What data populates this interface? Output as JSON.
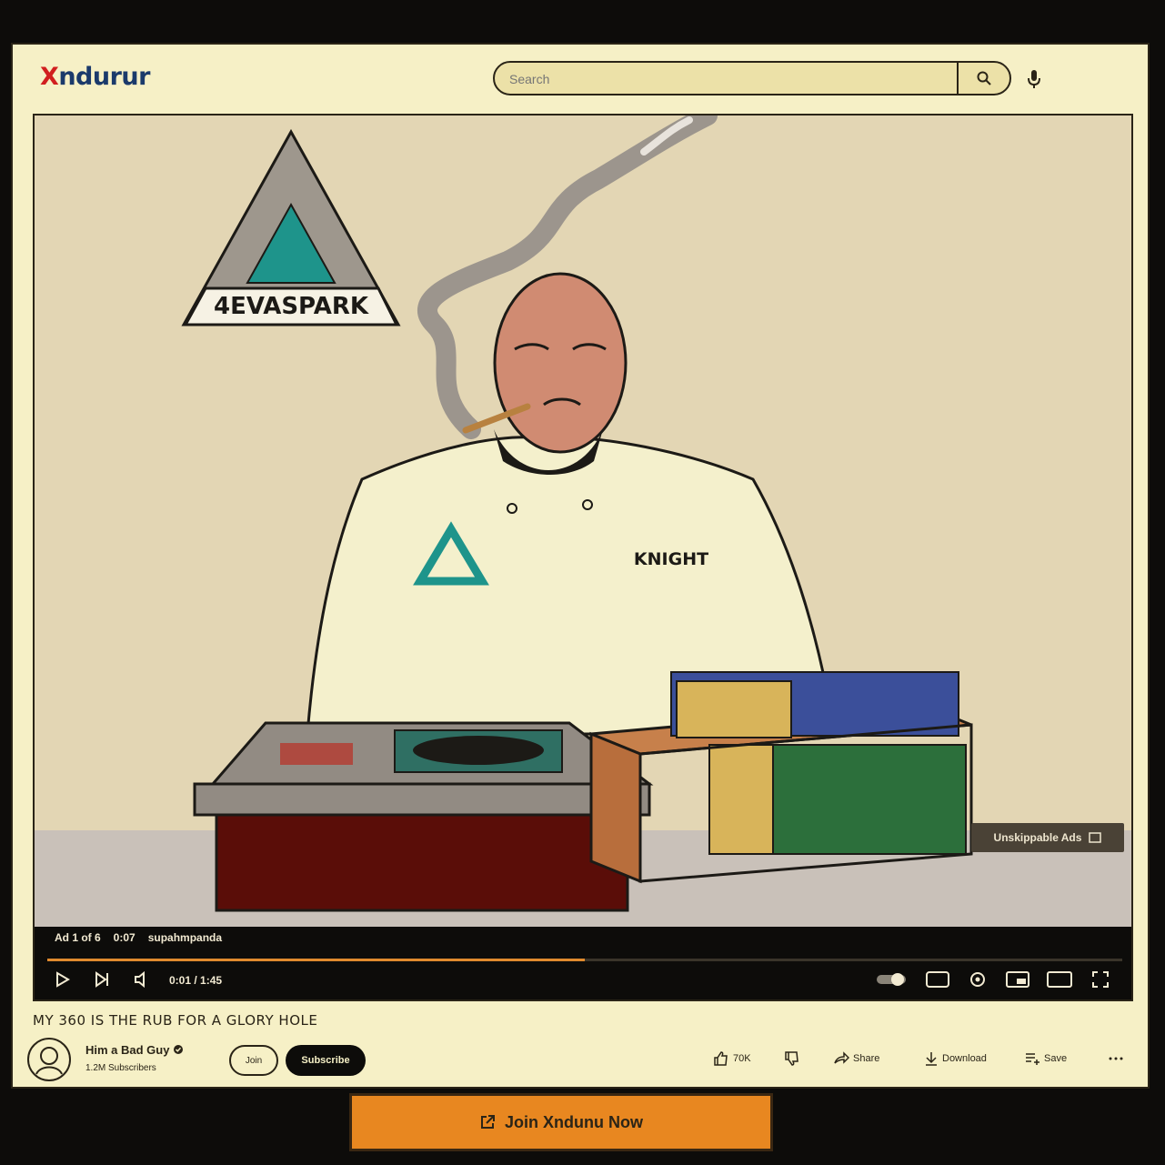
{
  "app": {
    "logo_first": "X",
    "logo_rest": "ndurur"
  },
  "search": {
    "placeholder": "Search",
    "button_icon": "search-icon",
    "mic_icon": "mic-icon"
  },
  "video": {
    "logo_text": "4EVASPARK",
    "jacket_text": "KNIGHT",
    "skip_ad_label": "Unskippable Ads",
    "ad_info": {
      "count": "Ad 1 of 6",
      "remaining": "0:07",
      "advertiser": "supahmpanda"
    },
    "progress": 0.5,
    "time": "0:01 / 1:45"
  },
  "details": {
    "title": "MY 360 IS THE RUB FOR A GLORY HOLE",
    "channel_name": "Him a Bad Guy",
    "subscribers": "1.2M Subscribers",
    "join_label": "Join",
    "subscribe_label": "Subscribe",
    "likes": "70K",
    "share_label": "Share",
    "download_label": "Download",
    "save_label": "Save"
  },
  "cta": {
    "label": "Join Xndunu Now",
    "icon": "external-link-icon"
  },
  "colors": {
    "accent": "#e88720",
    "brand_red": "#d11f1f",
    "brand_blue": "#1b3a6b",
    "paper": "#f6f0c6"
  }
}
